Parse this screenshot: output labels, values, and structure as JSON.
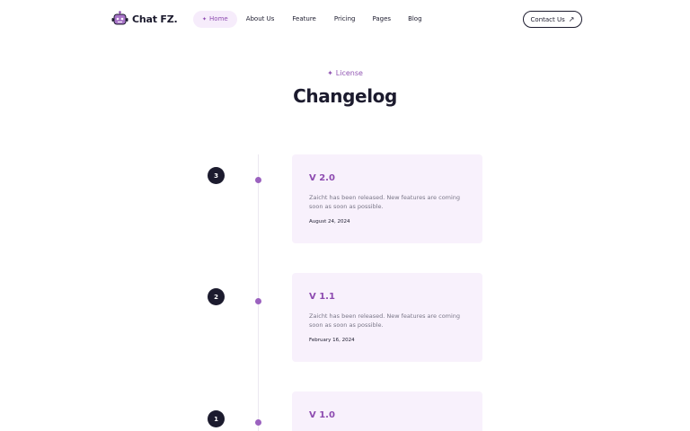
{
  "header": {
    "logo_text": "Chat FZ.",
    "nav": [
      {
        "label": "Home",
        "active": true
      },
      {
        "label": "About Us",
        "active": false
      },
      {
        "label": "Feature",
        "active": false
      },
      {
        "label": "Pricing",
        "active": false
      },
      {
        "label": "Pages",
        "active": false
      },
      {
        "label": "Blog",
        "active": false
      }
    ],
    "contact_label": "Contact Us"
  },
  "hero": {
    "eyebrow": "License",
    "title": "Changelog"
  },
  "timeline": [
    {
      "number": "3",
      "version": "V 2.0",
      "description": "Zaicht has been released. New features are coming soon as soon as possible.",
      "date": "August 24, 2024"
    },
    {
      "number": "2",
      "version": "V 1.1",
      "description": "Zaicht has been released. New features are coming soon as soon as possible.",
      "date": "February 16, 2024"
    },
    {
      "number": "1",
      "version": "V 1.0",
      "description": "",
      "date": ""
    }
  ],
  "colors": {
    "accent": "#8d4bb0",
    "dark": "#1c1b2e",
    "card_bg": "#f8f1fc"
  }
}
